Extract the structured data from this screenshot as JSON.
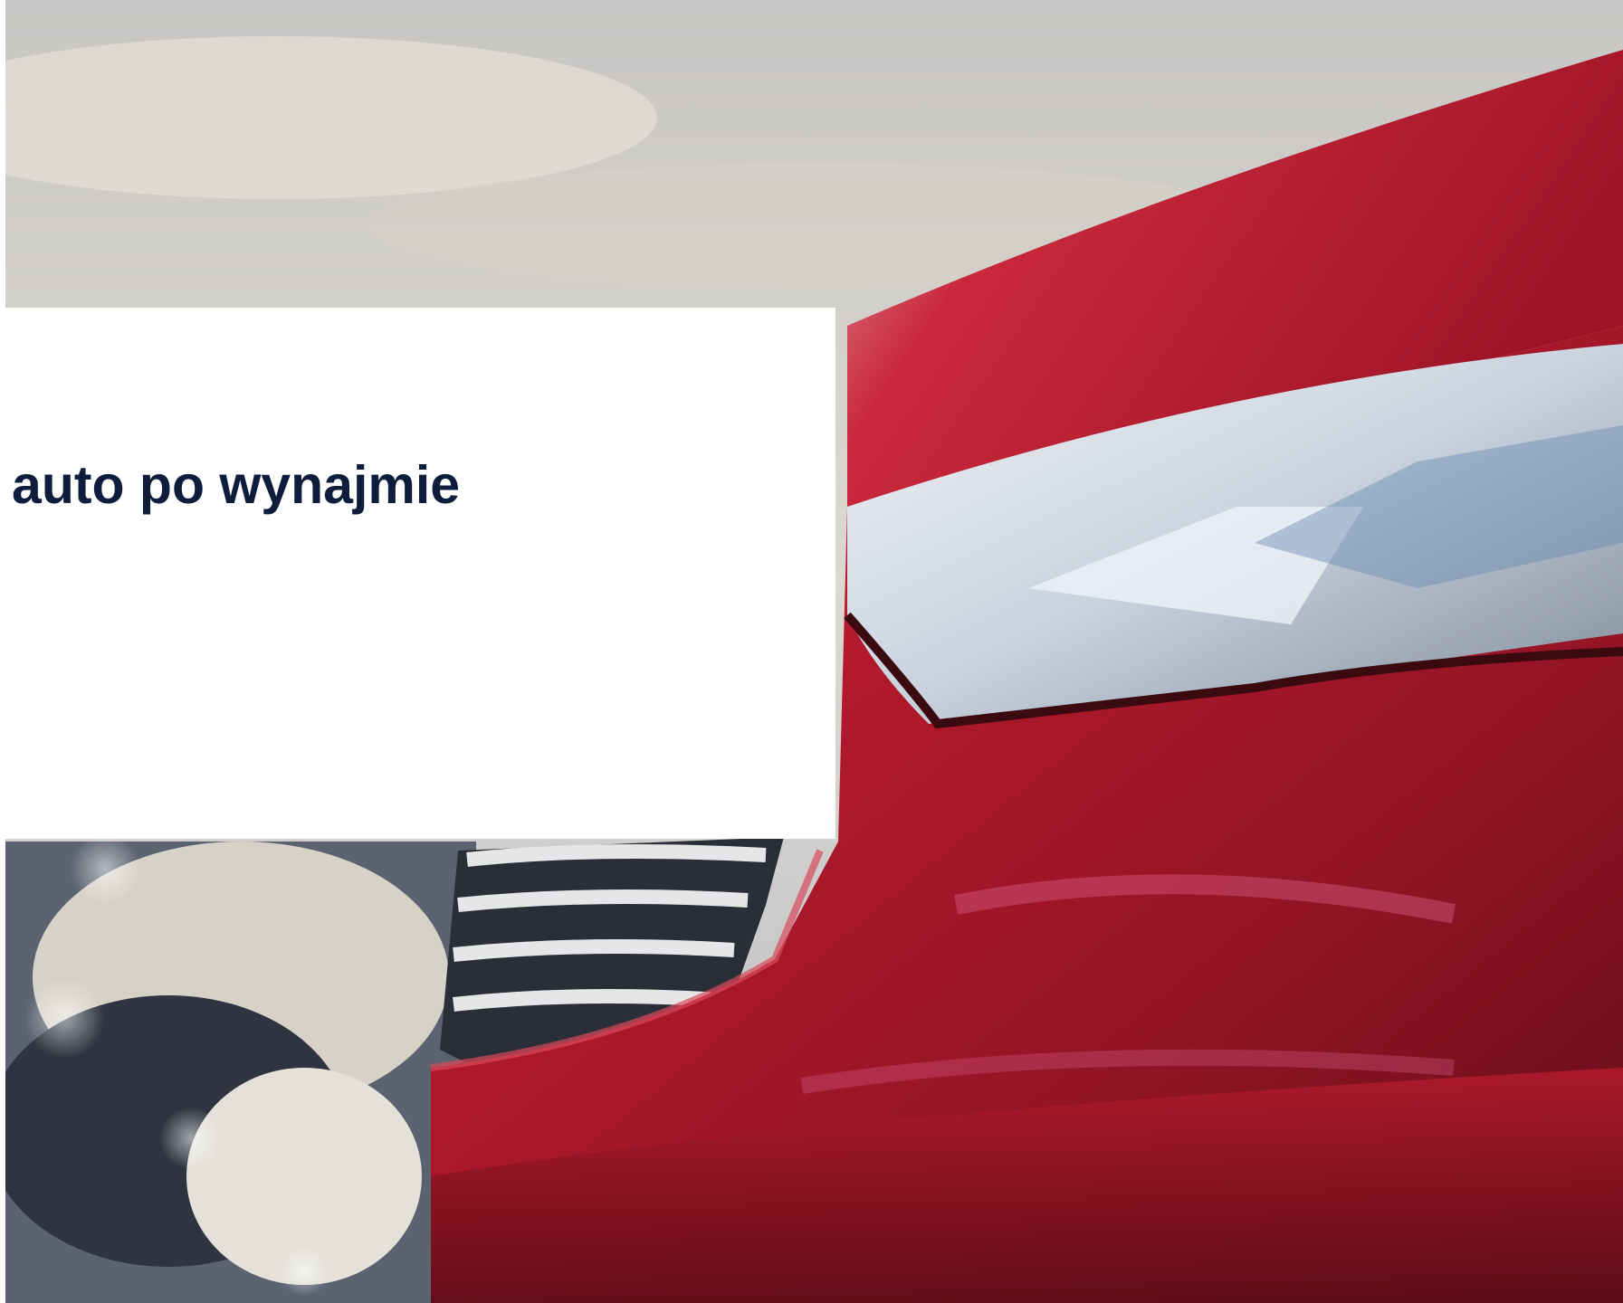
{
  "caption": {
    "title": "auto po wynajmie"
  },
  "colors": {
    "title_text": "#0f1d3d",
    "panel_background": "#ffffff",
    "car_body": "#b0182b"
  }
}
